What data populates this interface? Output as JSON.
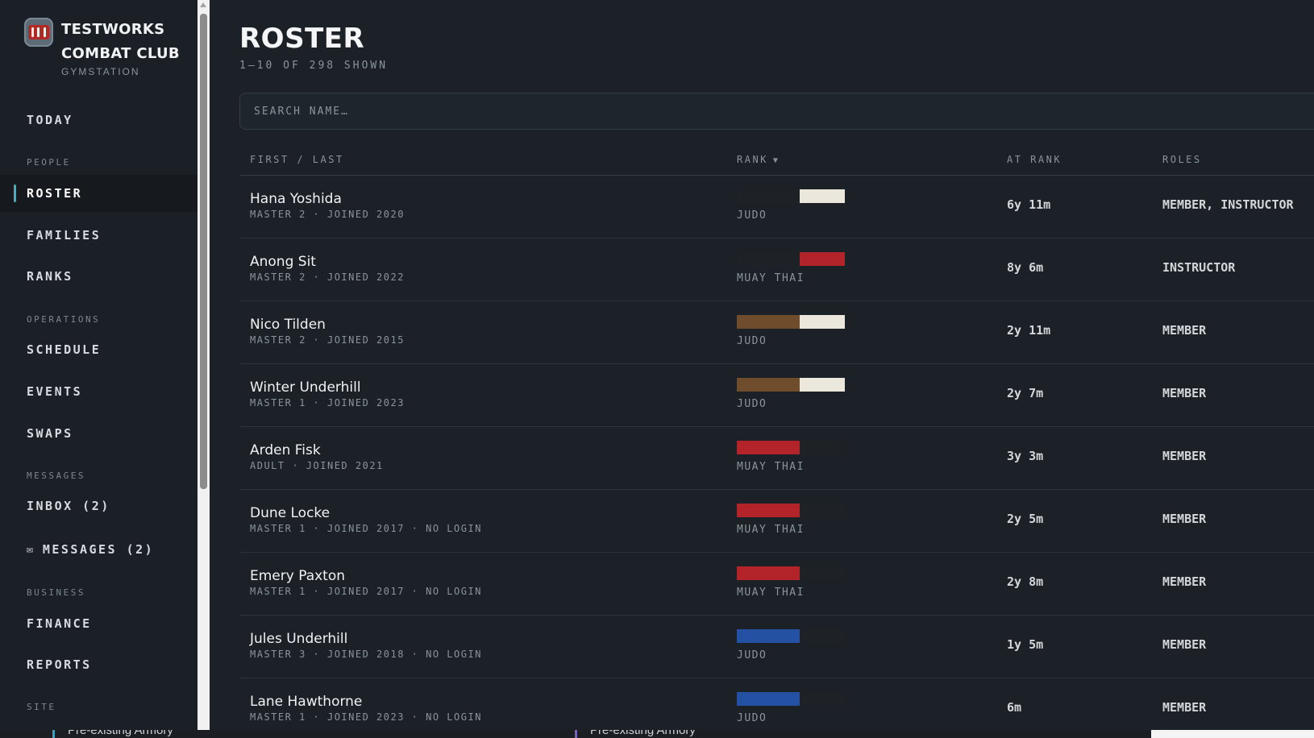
{
  "app": {
    "brand_name": "TESTWORKS COMBAT CLUB",
    "brand_sub": "GYMSTATION"
  },
  "sidebar": {
    "today": "TODAY",
    "sections": {
      "people": "PEOPLE",
      "operations": "OPERATIONS",
      "messages": "MESSAGES",
      "business": "BUSINESS",
      "site": "SITE"
    },
    "items": {
      "roster": "ROSTER",
      "families": "FAMILIES",
      "ranks": "RANKS",
      "schedule": "SCHEDULE",
      "events": "EVENTS",
      "swaps": "SWAPS",
      "inbox": "INBOX (2)",
      "messages": "MESSAGES (2)",
      "finance": "FINANCE",
      "reports": "REPORTS"
    },
    "icons": {
      "messages": "mail-icon"
    }
  },
  "page": {
    "title": "ROSTER",
    "count": "1–10 OF 298 SHOWN"
  },
  "search": {
    "placeholder": "SEARCH NAME…",
    "value": ""
  },
  "table": {
    "headers": {
      "name": "FIRST / LAST",
      "rank": "RANK",
      "at_rank": "AT RANK",
      "roles": "ROLES"
    },
    "sort_arrow": "▼",
    "rows": [
      {
        "name": "Hana Yoshida",
        "meta": "MASTER 2 · JOINED 2020",
        "discipline": "JUDO",
        "at_rank": "6y 11m",
        "roles": "MEMBER, INSTRUCTOR",
        "belt": [
          "#1e2226",
          "#ebe7dd"
        ]
      },
      {
        "name": "Anong Sit",
        "meta": "MASTER 2 · JOINED 2022",
        "discipline": "MUAY THAI",
        "at_rank": "8y 6m",
        "roles": "INSTRUCTOR",
        "belt": [
          "#1e2226",
          "#b3232a"
        ]
      },
      {
        "name": "Nico Tilden",
        "meta": "MASTER 2 · JOINED 2015",
        "discipline": "JUDO",
        "at_rank": "2y 11m",
        "roles": "MEMBER",
        "belt": [
          "#6e4c2c",
          "#ebe7dd"
        ]
      },
      {
        "name": "Winter Underhill",
        "meta": "MASTER 1 · JOINED 2023",
        "discipline": "JUDO",
        "at_rank": "2y 7m",
        "roles": "MEMBER",
        "belt": [
          "#6e4c2c",
          "#ebe7dd"
        ]
      },
      {
        "name": "Arden Fisk",
        "meta": "ADULT · JOINED 2021",
        "discipline": "MUAY THAI",
        "at_rank": "3y 3m",
        "roles": "MEMBER",
        "belt": [
          "#b3232a",
          "#1e2226"
        ]
      },
      {
        "name": "Dune Locke",
        "meta": "MASTER 1 · JOINED 2017 · NO LOGIN",
        "discipline": "MUAY THAI",
        "at_rank": "2y 5m",
        "roles": "MEMBER",
        "belt": [
          "#b3232a",
          "#1e2226"
        ]
      },
      {
        "name": "Emery Paxton",
        "meta": "MASTER 1 · JOINED 2017 · NO LOGIN",
        "discipline": "MUAY THAI",
        "at_rank": "2y 8m",
        "roles": "MEMBER",
        "belt": [
          "#b3232a",
          "#1e2226"
        ]
      },
      {
        "name": "Jules Underhill",
        "meta": "MASTER 3 · JOINED 2018 · NO LOGIN",
        "discipline": "JUDO",
        "at_rank": "1y 5m",
        "roles": "MEMBER",
        "belt": [
          "#2451a3",
          "#1e2226"
        ]
      },
      {
        "name": "Lane Hawthorne",
        "meta": "MASTER 1 · JOINED 2023 · NO LOGIN",
        "discipline": "JUDO",
        "at_rank": "6m",
        "roles": "MEMBER",
        "belt": [
          "#2451a3",
          "#1e2226"
        ]
      }
    ]
  },
  "background_window": {
    "tab_1": "Pre-existing Armory",
    "tab_2": "Pre-existing Armory"
  },
  "colors": {
    "accent": "#3fb0c4",
    "background": "#1c2127",
    "sidebar": "#1b2026"
  }
}
